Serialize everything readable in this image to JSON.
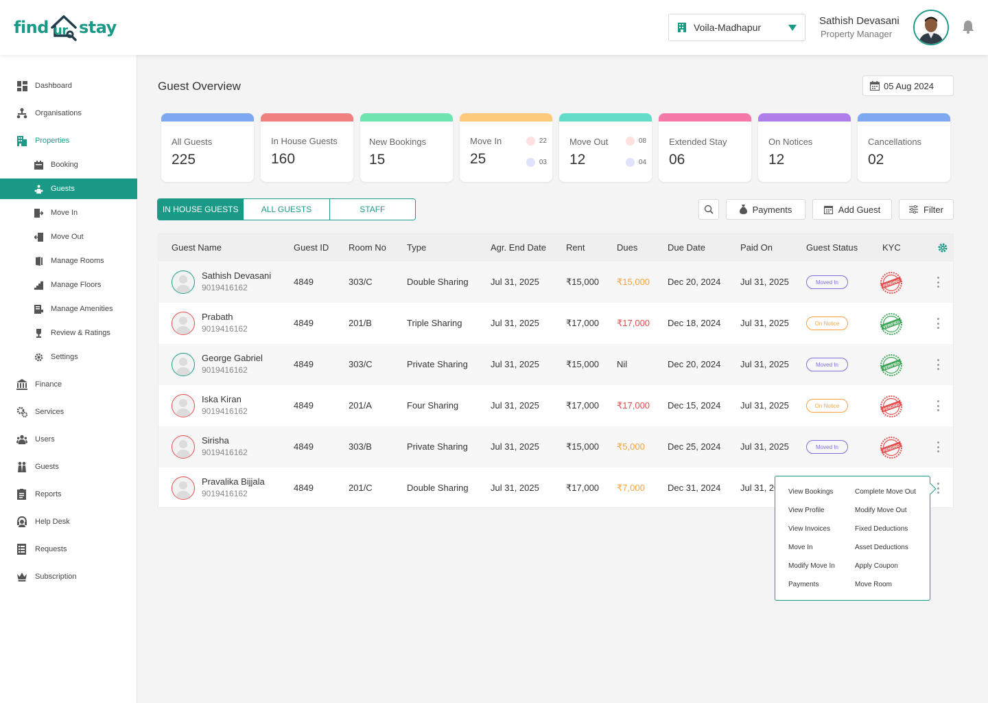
{
  "brand": {
    "logo_left": "find",
    "logo_mid": "ur",
    "logo_right": "stay",
    "accent": "#1a9a86"
  },
  "header": {
    "property": "Voila-Madhapur",
    "user_name": "Sathish Devasani",
    "user_role": "Property Manager"
  },
  "sidebar": {
    "items": [
      {
        "label": "Dashboard",
        "icon": "dashboard-icon"
      },
      {
        "label": "Organisations",
        "icon": "org-icon"
      },
      {
        "label": "Properties",
        "icon": "building-icon"
      },
      {
        "label": "Booking",
        "icon": "calendar-icon"
      },
      {
        "label": "Guests",
        "icon": "guests-icon"
      },
      {
        "label": "Move In",
        "icon": "move-in-icon"
      },
      {
        "label": "Move Out",
        "icon": "move-out-icon"
      },
      {
        "label": "Manage Rooms",
        "icon": "door-icon"
      },
      {
        "label": "Manage Floors",
        "icon": "stairs-icon"
      },
      {
        "label": "Manage Amenities",
        "icon": "amenities-icon"
      },
      {
        "label": "Review & Ratings",
        "icon": "trophy-icon"
      },
      {
        "label": "Settings",
        "icon": "gear-icon"
      },
      {
        "label": "Finance",
        "icon": "bank-icon"
      },
      {
        "label": "Services",
        "icon": "services-icon"
      },
      {
        "label": "Users",
        "icon": "users-icon"
      },
      {
        "label": "Guests",
        "icon": "guests-group-icon"
      },
      {
        "label": "Reports",
        "icon": "reports-icon"
      },
      {
        "label": "Help Desk",
        "icon": "headset-icon"
      },
      {
        "label": "Requests",
        "icon": "requests-icon"
      },
      {
        "label": "Subscription",
        "icon": "crown-icon"
      }
    ]
  },
  "main": {
    "title": "Guest Overview",
    "date": "05 Aug 2024",
    "stats": [
      {
        "label": "All Guests",
        "value": "225",
        "color": "#7ea9f0"
      },
      {
        "label": "In House Guests",
        "value": "160",
        "color": "#f08080"
      },
      {
        "label": "New Bookings",
        "value": "15",
        "color": "#6fe3b0"
      },
      {
        "label": "Move In",
        "value": "25",
        "color": "#fdc97a",
        "sub1": "22",
        "sub2": "03"
      },
      {
        "label": "Move Out",
        "value": "12",
        "color": "#63dcc8",
        "sub1": "08",
        "sub2": "04"
      },
      {
        "label": "Extended Stay",
        "value": "06",
        "color": "#f478a8"
      },
      {
        "label": "On Notices",
        "value": "12",
        "color": "#b07ee8"
      },
      {
        "label": "Cancellations",
        "value": "02",
        "color": "#7ea9f0"
      }
    ],
    "tabs": [
      "IN HOUSE GUESTS",
      "ALL GUESTS",
      "STAFF"
    ],
    "actions": {
      "payments": "Payments",
      "add_guest": "Add Guest",
      "filter": "Filter"
    },
    "columns": [
      "Guest Name",
      "Guest ID",
      "Room No",
      "Type",
      "Agr. End Date",
      "Rent",
      "Dues",
      "Due Date",
      "Paid On",
      "Guest Status",
      "KYC"
    ],
    "rows": [
      {
        "name": "Sathish Devasani",
        "phone": "9019416162",
        "id": "4849",
        "room": "303/C",
        "type": "Double Sharing",
        "agr_end": "Jul 31, 2025",
        "rent": "₹15,000",
        "dues": "₹15,000",
        "due_date": "Dec 20, 2024",
        "paid_on": "Jul 31, 2025",
        "status": "Moved In",
        "kyc": "PENDING"
      },
      {
        "name": "Prabath",
        "phone": "9019416162",
        "id": "4849",
        "room": "201/B",
        "type": "Triple Sharing",
        "agr_end": "Jul 31, 2025",
        "rent": "₹17,000",
        "dues": "₹17,000",
        "due_date": "Dec 18, 2024",
        "paid_on": "Jul 31, 2025",
        "status": "On Notice",
        "kyc": "VERIFIED"
      },
      {
        "name": "George Gabriel",
        "phone": "9019416162",
        "id": "4849",
        "room": "303/C",
        "type": "Private Sharing",
        "agr_end": "Jul 31, 2025",
        "rent": "₹15,000",
        "dues": "Nil",
        "due_date": "Dec 20, 2024",
        "paid_on": "Jul 31, 2025",
        "status": "Moved In",
        "kyc": "VERIFIED"
      },
      {
        "name": "Iska Kiran",
        "phone": "9019416162",
        "id": "4849",
        "room": "201/A",
        "type": "Four Sharing",
        "agr_end": "Jul 31, 2025",
        "rent": "₹17,000",
        "dues": "₹17,000",
        "due_date": "Dec 15, 2024",
        "paid_on": "Jul 31, 2025",
        "status": "On Notice",
        "kyc": "PENDING"
      },
      {
        "name": "Sirisha",
        "phone": "9019416162",
        "id": "4849",
        "room": "303/B",
        "type": "Private Sharing",
        "agr_end": "Jul 31, 2025",
        "rent": "₹15,000",
        "dues": "₹5,000",
        "due_date": "Dec 25, 2024",
        "paid_on": "Jul 31, 2025",
        "status": "Moved In",
        "kyc": "PENDING"
      },
      {
        "name": "Pravalika Bijjala",
        "phone": "9019416162",
        "id": "4849",
        "room": "201/C",
        "type": "Double Sharing",
        "agr_end": "Jul 31, 2025",
        "rent": "₹17,000",
        "dues": "₹7,000",
        "due_date": "Dec 31, 2024",
        "paid_on": "Jul 31, 20"
      }
    ],
    "context_menu": {
      "left": [
        "View Bookings",
        "View Profile",
        "View Invoices",
        "Move In",
        "Modify Move In",
        "Payments"
      ],
      "right": [
        "Complete Move Out",
        "Modify Move Out",
        "Fixed Deductions",
        "Asset Deductions",
        "Apply Coupon",
        "Move Room"
      ]
    }
  }
}
